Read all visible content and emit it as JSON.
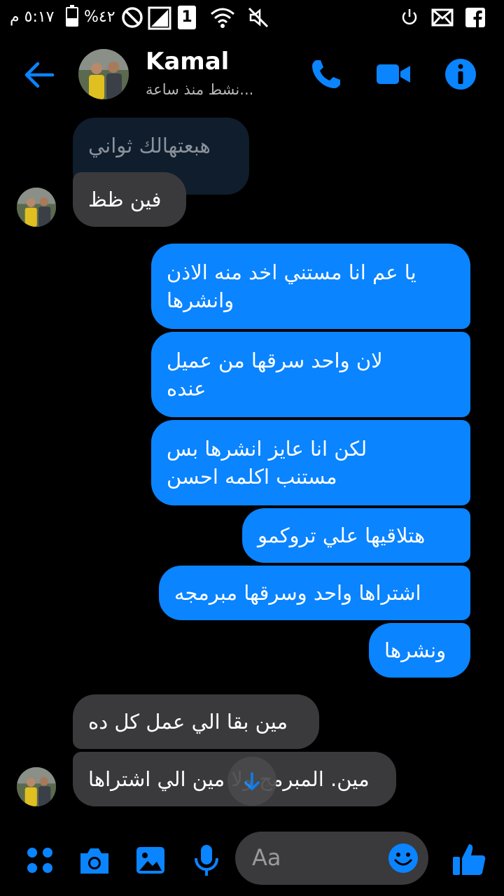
{
  "status_bar": {
    "time": "٥:١٧ م",
    "battery_percent": "%٤٢",
    "sim_badge": "1",
    "battery_level": 0.42
  },
  "header": {
    "contact_name": "Kamal",
    "status": "نشط منذ ساعة...",
    "icons": [
      "back-arrow-icon",
      "phone-icon",
      "video-icon",
      "info-icon"
    ]
  },
  "messages": [
    {
      "dir": "in",
      "text": "هبعتهالك ثواني",
      "faded": true
    },
    {
      "dir": "in",
      "text": "فين ظظ"
    },
    {
      "dir": "out",
      "lines": [
        "يا عم انا مستني اخد منه الاذن",
        "وانشرها"
      ]
    },
    {
      "dir": "out",
      "lines": [
        "لان واحد سرقها من عميل",
        "عنده"
      ]
    },
    {
      "dir": "out",
      "lines": [
        "لكن انا عايز انشرها بس",
        "مستنب اكلمه احسن"
      ]
    },
    {
      "dir": "out",
      "text": "هتلاقيها علي تروكمو"
    },
    {
      "dir": "out",
      "text": "اشتراها واحد وسرقها مبرمجه"
    },
    {
      "dir": "out",
      "text": "ونشرها"
    },
    {
      "dir": "in",
      "text": "مين بقا الي عمل كل ده"
    },
    {
      "dir": "in",
      "text": "مين. المبرمج ولا مين الي اشتراها"
    }
  ],
  "composer": {
    "placeholder": "Aa",
    "icons": [
      "apps-icon",
      "camera-icon",
      "gallery-icon",
      "mic-icon",
      "emoji-icon",
      "thumbs-up-icon"
    ]
  },
  "colors": {
    "accent": "#0a84ff",
    "incoming_bubble": "#3a3a3c",
    "background": "#000000"
  }
}
